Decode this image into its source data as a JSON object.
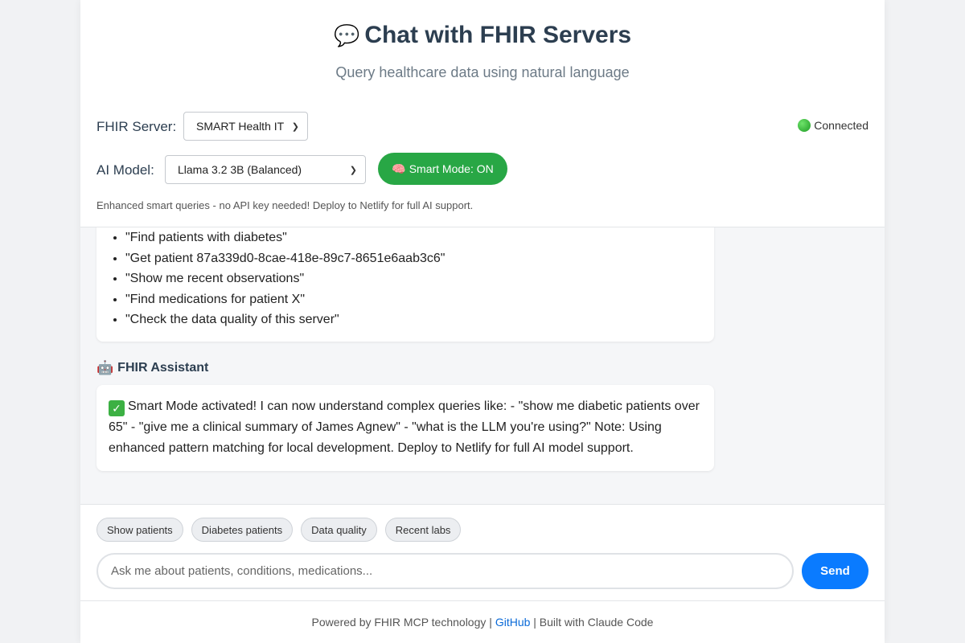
{
  "header": {
    "icon": "speech-bubble-icon",
    "title": "Chat with FHIR Servers",
    "subtitle": "Query healthcare data using natural language"
  },
  "controls": {
    "server_label": "FHIR Server:",
    "server_selected": "SMART Health IT",
    "model_label": "AI Model:",
    "model_selected": "Llama 3.2 3B (Balanced)",
    "smart_mode_label": "Smart Mode: ON",
    "smart_mode_icon": "brain-icon",
    "status_text": "Connected",
    "status_color": "#28a745",
    "hint": "Enhanced smart queries - no API key needed! Deploy to Netlify for full AI support."
  },
  "chat": {
    "examples": [
      "\"Find patients with diabetes\"",
      "\"Get patient 87a339d0-8cae-418e-89c7-8651e6aab3c6\"",
      "\"Show me recent observations\"",
      "\"Find medications for patient X\"",
      "\"Check the data quality of this server\""
    ],
    "assistant_name": "FHIR Assistant",
    "assistant_icon": "robot-icon",
    "assistant_message": "Smart Mode activated! I can now understand complex queries like: - \"show me diabetic patients over 65\" - \"give me a clinical summary of James Agnew\" - \"what is the LLM you're using?\" Note: Using enhanced pattern matching for local development. Deploy to Netlify for full AI model support."
  },
  "quick_actions": [
    "Show patients",
    "Diabetes patients",
    "Data quality",
    "Recent labs"
  ],
  "input": {
    "placeholder": "Ask me about patients, conditions, medications...",
    "value": "",
    "send_label": "Send"
  },
  "footer": {
    "prefix": "Powered by FHIR MCP technology | ",
    "link": "GitHub",
    "suffix": " | Built with Claude Code"
  },
  "colors": {
    "accent": "#0a7bff",
    "smart_mode": "#28a745",
    "title": "#2c3e50"
  }
}
